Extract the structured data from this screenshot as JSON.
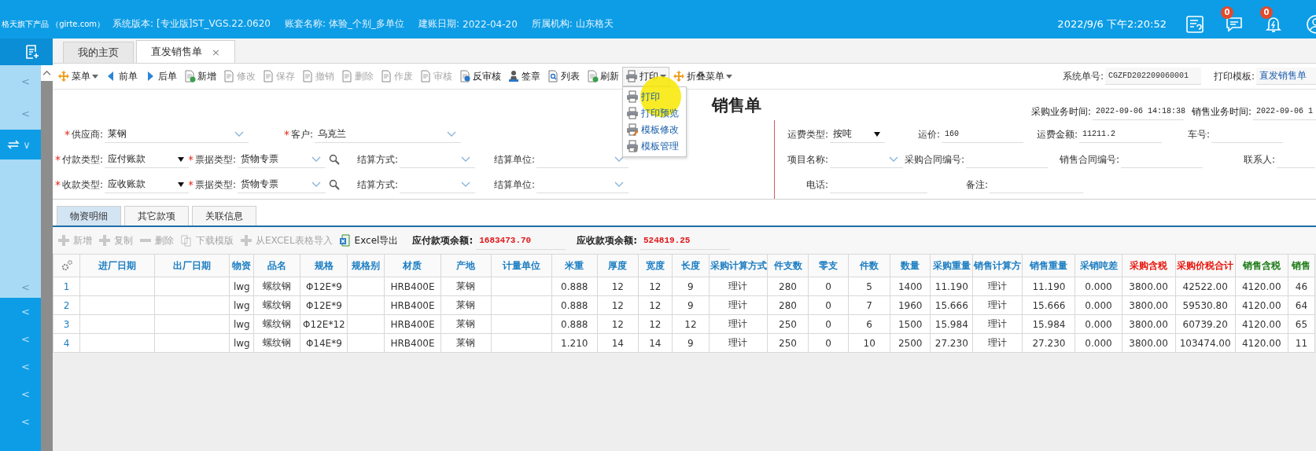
{
  "header": {
    "logo": "格天旗下产品 （girte.com）",
    "info": [
      {
        "label": "系统版本:",
        "value": "[专业版]ST_VGS.22.0620"
      },
      {
        "label": "账套名称:",
        "value": "体验_个别_多单位"
      },
      {
        "label": "建账日期:",
        "value": "2022-04-20"
      },
      {
        "label": "所属机构:",
        "value": "山东格天"
      }
    ],
    "datetime": "2022/9/6 下午2:20:52",
    "icons": [
      {
        "kind": "help"
      },
      {
        "kind": "message",
        "badge": "0"
      },
      {
        "kind": "alert",
        "badge": "0"
      },
      {
        "kind": "user"
      }
    ]
  },
  "sidebar": {
    "items": [
      {
        "kind": "add"
      },
      {
        "kind": "sub",
        "label": "<"
      },
      {
        "kind": "sub",
        "label": "<"
      },
      {
        "kind": "switch",
        "label": "∨"
      },
      {
        "kind": "sub",
        "label": "<"
      },
      {
        "kind": "main",
        "label": "<"
      },
      {
        "kind": "main",
        "label": "<"
      },
      {
        "kind": "main",
        "label": "<"
      },
      {
        "kind": "main",
        "label": "<"
      },
      {
        "kind": "main",
        "label": "<"
      }
    ]
  },
  "tabs": [
    {
      "label": "我的主页",
      "selected": false
    },
    {
      "label": "直发销售单",
      "selected": true,
      "close": "×"
    }
  ],
  "toolbar": {
    "items": [
      {
        "label": "菜单",
        "kind": "move",
        "dropdown": true,
        "disabled": false,
        "expanded": false
      },
      {
        "label": "前单",
        "kind": "prev",
        "dropdown": false,
        "disabled": false,
        "expanded": false
      },
      {
        "label": "后单",
        "kind": "next",
        "dropdown": false,
        "disabled": false,
        "expanded": false
      },
      {
        "label": "新增",
        "kind": "new",
        "dropdown": false,
        "disabled": false,
        "expanded": false
      },
      {
        "label": "修改",
        "kind": "edit",
        "dropdown": false,
        "disabled": true,
        "expanded": false
      },
      {
        "label": "保存",
        "kind": "save",
        "dropdown": false,
        "disabled": true,
        "expanded": false
      },
      {
        "label": "撤销",
        "kind": "undo",
        "dropdown": false,
        "disabled": true,
        "expanded": false
      },
      {
        "label": "删除",
        "kind": "delete",
        "dropdown": false,
        "disabled": true,
        "expanded": false
      },
      {
        "label": "作废",
        "kind": "void",
        "dropdown": false,
        "disabled": true,
        "expanded": false
      },
      {
        "label": "审核",
        "kind": "audit",
        "dropdown": false,
        "disabled": true,
        "expanded": false
      },
      {
        "label": "反审核",
        "kind": "unaudit",
        "dropdown": false,
        "disabled": false,
        "expanded": false
      },
      {
        "label": "签章",
        "kind": "stamp",
        "dropdown": false,
        "disabled": false,
        "expanded": false
      },
      {
        "label": "列表",
        "kind": "list",
        "dropdown": false,
        "disabled": false,
        "expanded": false
      },
      {
        "label": "刷新",
        "kind": "refresh",
        "dropdown": false,
        "disabled": false,
        "expanded": false
      },
      {
        "label": "打印",
        "kind": "print",
        "dropdown": true,
        "disabled": false,
        "expanded": true,
        "menu": [
          {
            "label": "打印",
            "kind": "print"
          },
          {
            "label": "打印预览",
            "kind": "print"
          },
          {
            "label": "模板修改",
            "kind": "print-edit"
          },
          {
            "label": "模板管理",
            "kind": "print-gear"
          }
        ]
      },
      {
        "label": "折叠菜单",
        "kind": "move",
        "dropdown": true,
        "disabled": false,
        "expanded": false
      }
    ],
    "system_no": {
      "label": "系统单号:",
      "value": "CGZFD202209060001"
    },
    "print_template": {
      "label": "打印模板:",
      "value": "直发销售单"
    }
  },
  "form": {
    "title": "销售单",
    "times": [
      {
        "label": "采购业务时间:",
        "value": "2022-09-06 14:18:38"
      },
      {
        "label": "销售业务时间:",
        "value": "2022-09-06 1"
      }
    ],
    "left_rows": [
      [
        {
          "mark": "*",
          "label": "供应商:",
          "value": "莱钢",
          "kind": "combo"
        },
        {
          "mark": "*",
          "label": "客户:",
          "value": "乌克兰",
          "kind": "combo"
        }
      ],
      [
        {
          "mark": "*",
          "label": "付款类型:",
          "value": "应付账款",
          "kind": "select"
        },
        {
          "mark": "*",
          "label": "票据类型:",
          "value": "货物专票",
          "kind": "lookup"
        },
        {
          "label": "结算方式:",
          "kind": "combo"
        },
        {
          "label": "结算单位:",
          "kind": "combo"
        }
      ],
      [
        {
          "mark": "*",
          "label": "收款类型:",
          "value": "应收账款",
          "kind": "select"
        },
        {
          "mark": "*",
          "label": "票据类型:",
          "value": "货物专票",
          "kind": "lookup"
        },
        {
          "label": "结算方式:",
          "kind": "combo"
        },
        {
          "label": "结算单位:",
          "kind": "combo"
        }
      ]
    ],
    "right_rows": [
      [
        {
          "label": "运费类型:",
          "value": "按吨",
          "kind": "select"
        },
        {
          "label": "运价:",
          "value": "160",
          "kind": "text"
        },
        {
          "label": "运费金额:",
          "value": "11211.2",
          "kind": "text"
        },
        {
          "label": "车号:",
          "kind": "text"
        }
      ],
      [
        {
          "label": "项目名称:",
          "kind": "combo"
        },
        {
          "label": "采购合同编号:",
          "kind": "text"
        },
        {
          "label": "销售合同编号:",
          "kind": "text"
        },
        {
          "label": "联系人:",
          "kind": "text"
        }
      ],
      [
        {
          "label": "电话:",
          "kind": "text"
        },
        {
          "label": "备注:",
          "kind": "text"
        }
      ]
    ]
  },
  "detail": {
    "tabs": [
      {
        "label": "物资明细",
        "selected": true
      },
      {
        "label": "其它款项",
        "selected": false
      },
      {
        "label": "关联信息",
        "selected": false
      }
    ],
    "actions": [
      {
        "label": "新增",
        "kind": "plus",
        "disabled": true
      },
      {
        "label": "复制",
        "kind": "plus",
        "disabled": true
      },
      {
        "label": "删除",
        "kind": "minus",
        "disabled": true
      },
      {
        "label": "下载模版",
        "kind": "copy",
        "disabled": true
      },
      {
        "label": "从EXCEL表格导入",
        "kind": "plus",
        "disabled": true
      },
      {
        "label": "Excel导出",
        "kind": "excel",
        "disabled": false
      }
    ],
    "balances": [
      {
        "label": "应付款项余额:",
        "value": "1683473.70"
      },
      {
        "label": "应收款项余额:",
        "value": "524819.25"
      }
    ]
  },
  "table": {
    "columns": [
      {
        "label": "进厂日期",
        "color": "#1b7dc2"
      },
      {
        "label": "出厂日期",
        "color": "#1b7dc2"
      },
      {
        "label": "物资",
        "color": "#1b7dc2"
      },
      {
        "label": "品名",
        "color": "#1b7dc2"
      },
      {
        "label": "规格",
        "color": "#1b7dc2"
      },
      {
        "label": "规格别",
        "color": "#1b7dc2"
      },
      {
        "label": "材质",
        "color": "#1b7dc2"
      },
      {
        "label": "产地",
        "color": "#1b7dc2"
      },
      {
        "label": "计量单位",
        "color": "#1b7dc2"
      },
      {
        "label": "米重",
        "color": "#1b7dc2"
      },
      {
        "label": "厚度",
        "color": "#1b7dc2"
      },
      {
        "label": "宽度",
        "color": "#1b7dc2"
      },
      {
        "label": "长度",
        "color": "#1b7dc2"
      },
      {
        "label": "采购计算方式",
        "color": "#1b7dc2"
      },
      {
        "label": "件支数",
        "color": "#1b7dc2"
      },
      {
        "label": "零支",
        "color": "#1b7dc2"
      },
      {
        "label": "件数",
        "color": "#1b7dc2"
      },
      {
        "label": "数量",
        "color": "#1b7dc2"
      },
      {
        "label": "采购重量",
        "color": "#1b7dc2"
      },
      {
        "label": "销售计算方",
        "color": "#1b7dc2"
      },
      {
        "label": "销售重量",
        "color": "#1b7dc2"
      },
      {
        "label": "采销吨差",
        "color": "#1b7dc2"
      },
      {
        "label": "采购含税",
        "color": "#e8160c"
      },
      {
        "label": "采购价税合计",
        "color": "#e8160c"
      },
      {
        "label": "销售含税",
        "color": "#1a7a14"
      },
      {
        "label": "销售",
        "color": "#1a7a14"
      }
    ],
    "rows": [
      {
        "no": "1",
        "cells": [
          null,
          null,
          "lwg",
          "螺纹钢",
          "Φ12E*9",
          null,
          "HRB400E",
          "莱钢",
          null,
          "0.888",
          "12",
          "12",
          "9",
          "理计",
          "280",
          "0",
          "5",
          "1400",
          "11.190",
          "理计",
          "11.190",
          "0.000",
          "3800.00",
          "42522.00",
          "4120.00",
          "46"
        ]
      },
      {
        "no": "2",
        "cells": [
          null,
          null,
          "lwg",
          "螺纹钢",
          "Φ12E*9",
          null,
          "HRB400E",
          "莱钢",
          null,
          "0.888",
          "12",
          "12",
          "9",
          "理计",
          "280",
          "0",
          "7",
          "1960",
          "15.666",
          "理计",
          "15.666",
          "0.000",
          "3800.00",
          "59530.80",
          "4120.00",
          "64"
        ]
      },
      {
        "no": "3",
        "cells": [
          null,
          null,
          "lwg",
          "螺纹钢",
          "Φ12E*12",
          null,
          "HRB400E",
          "莱钢",
          null,
          "0.888",
          "12",
          "12",
          "12",
          "理计",
          "250",
          "0",
          "6",
          "1500",
          "15.984",
          "理计",
          "15.984",
          "0.000",
          "3800.00",
          "60739.20",
          "4120.00",
          "65"
        ]
      },
      {
        "no": "4",
        "cells": [
          null,
          null,
          "lwg",
          "螺纹钢",
          "Φ14E*9",
          null,
          "HRB400E",
          "莱钢",
          null,
          "1.210",
          "14",
          "14",
          "9",
          "理计",
          "250",
          "0",
          "10",
          "2500",
          "27.230",
          "理计",
          "27.230",
          "0.000",
          "3800.00",
          "103474.00",
          "4120.00",
          "11"
        ]
      }
    ]
  }
}
